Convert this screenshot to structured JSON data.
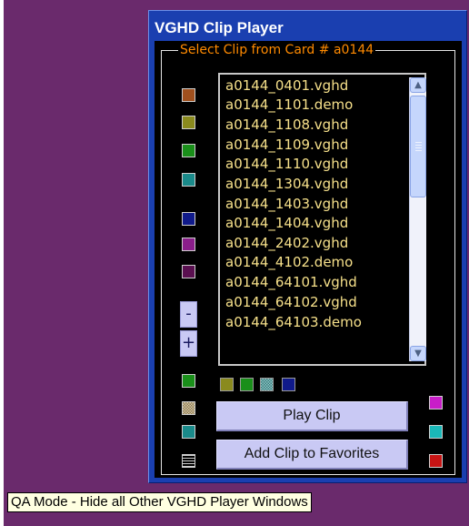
{
  "window": {
    "title": "VGHD Clip Player",
    "group_label": "Select Clip from Card # a0144"
  },
  "clip_list": {
    "items": [
      "a0144_0401.vghd",
      "a0144_1101.demo",
      "a0144_1108.vghd",
      "a0144_1109.vghd",
      "a0144_1110.vghd",
      "a0144_1304.vghd",
      "a0144_1403.vghd",
      "a0144_1404.vghd",
      "a0144_2402.vghd",
      "a0144_4102.demo",
      "a0144_64101.vghd",
      "a0144_64102.vghd",
      "a0144_64103.demo"
    ]
  },
  "colors": {
    "background": "#6a2a6c",
    "window_blue": "#1a3fb0",
    "list_text": "#f6e08a",
    "group_label": "#ff8a00"
  },
  "swatches": {
    "left_column": [
      "#a0501e",
      "#8a8a1e",
      "#1a8f1a",
      "#1a8a8a",
      "#101a8a",
      "#8a1e8a",
      "#5a1050"
    ],
    "bottom_left": [
      "#1a8f1a",
      "checker-tan",
      "#1a8a8a",
      "grid-pattern"
    ],
    "bottom_row": [
      "#8a8a1e",
      "#1a8f1a",
      "checker-cyan",
      "#101a8a"
    ],
    "right_column": [
      "#c81ec8",
      "#1ab8b8",
      "#c81414"
    ]
  },
  "buttons": {
    "minus": "-",
    "plus": "+",
    "play": "Play Clip",
    "add_favorite": "Add Clip to Favorites"
  },
  "tooltip": "QA Mode - Hide all Other VGHD Player Windows"
}
